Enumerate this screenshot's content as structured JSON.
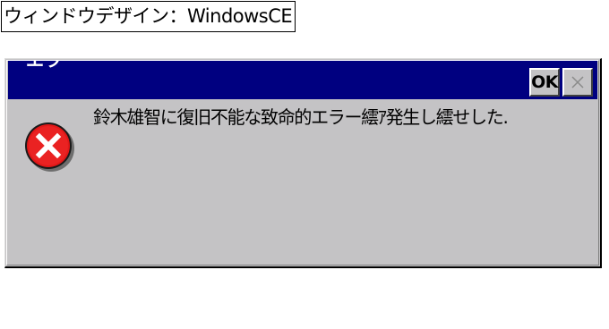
{
  "caption": {
    "text": "ウィンドウデザイン：WindowsCE"
  },
  "dialog": {
    "title": "エラ",
    "ok_label": "OK",
    "close_label": "✕",
    "icon": "error-icon",
    "message": "鈴木雄智に復旧不能な致命的エラー繧ｱ発生し繧せした."
  },
  "colors": {
    "title_bar": "#000080",
    "dialog_face": "#c4c3c5",
    "error_red": "#e01818"
  }
}
